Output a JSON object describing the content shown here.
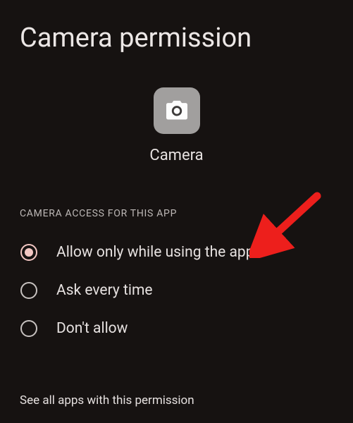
{
  "title": "Camera permission",
  "app": {
    "name": "Camera",
    "icon": "camera-icon"
  },
  "section_header": "CAMERA ACCESS FOR THIS APP",
  "options": [
    {
      "label": "Allow only while using the app",
      "selected": true
    },
    {
      "label": "Ask every time",
      "selected": false
    },
    {
      "label": "Don't allow",
      "selected": false
    }
  ],
  "footer_link": "See all apps with this permission",
  "annotation": {
    "arrow_color": "#ed1f1c",
    "target": "option-allow-while-using"
  }
}
